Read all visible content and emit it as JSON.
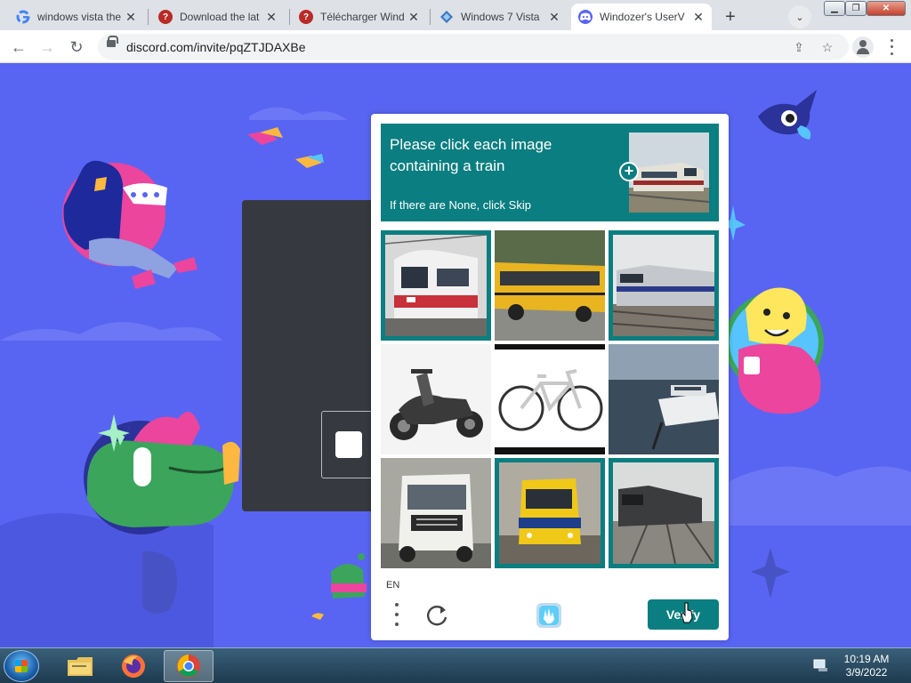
{
  "browser": {
    "tabs": [
      {
        "title": "windows vista the",
        "favicon": "google-icon"
      },
      {
        "title": "Download the lat",
        "favicon": "quora-icon"
      },
      {
        "title": "Télécharger Wind",
        "favicon": "quora-icon"
      },
      {
        "title": "Windows 7 Vista",
        "favicon": "site-icon"
      },
      {
        "title": "Windozer's UserV",
        "favicon": "discord-icon",
        "active": true
      }
    ],
    "url": "discord.com/invite/pqZTJDAXBe"
  },
  "captcha": {
    "prompt_line1": "Please click each image",
    "prompt_line2": "containing a train",
    "skip_hint": "If there are None, click Skip",
    "example_image": "train",
    "tiles": [
      {
        "subject": "red-white commuter train",
        "selected": true
      },
      {
        "subject": "yellow school bus",
        "selected": false
      },
      {
        "subject": "locomotive pulling passenger cars",
        "selected": true
      },
      {
        "subject": "scooter",
        "selected": false
      },
      {
        "subject": "bicycle",
        "selected": false
      },
      {
        "subject": "boat on water",
        "selected": false
      },
      {
        "subject": "white truck",
        "selected": false
      },
      {
        "subject": "yellow commuter train",
        "selected": true
      },
      {
        "subject": "dark train on tracks",
        "selected": true
      }
    ],
    "language": "EN",
    "verify_label": "Verify",
    "accent_color": "#0a7e80"
  },
  "page": {
    "background_color": "#5865f2"
  },
  "taskbar": {
    "time": "10:19 AM",
    "date": "3/9/2022",
    "pinned": [
      "file-explorer-icon",
      "firefox-icon",
      "chrome-icon"
    ]
  }
}
